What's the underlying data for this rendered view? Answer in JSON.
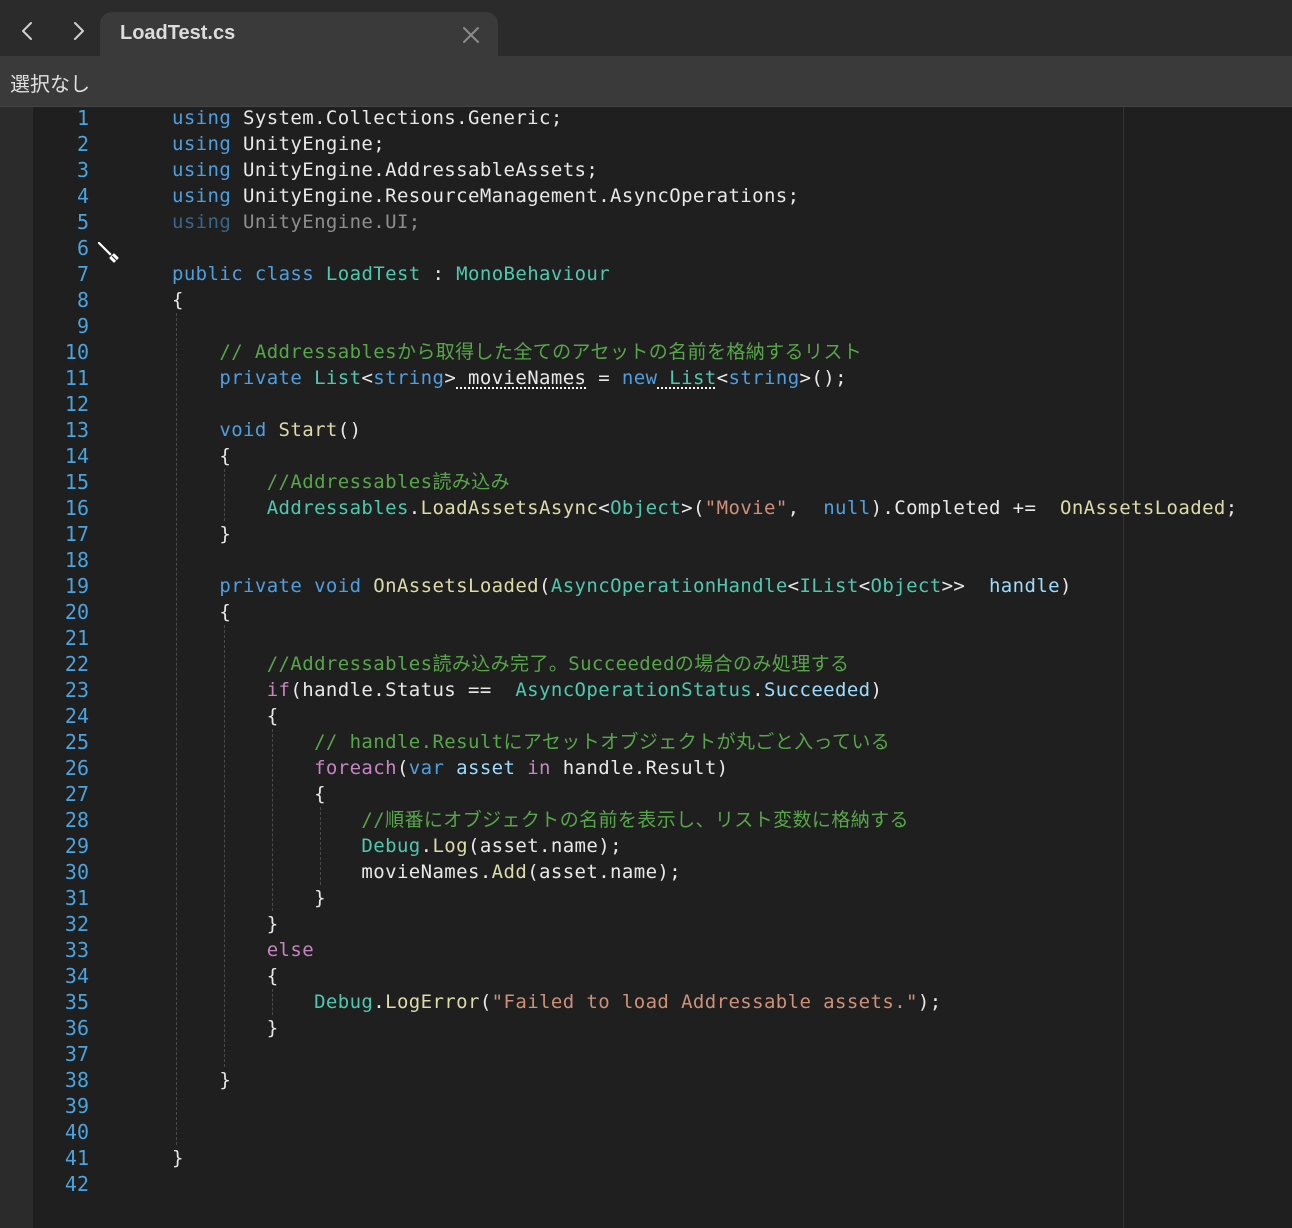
{
  "tab": {
    "title": "LoadTest.cs"
  },
  "breadcrumb": {
    "label": "選択なし"
  },
  "icons": {
    "back": "chevron-left-icon",
    "forward": "chevron-right-icon",
    "close": "close-icon",
    "cursor": "pencil-icon"
  },
  "colors": {
    "keyword": "#4f9fe0",
    "control": "#c586c0",
    "type": "#4ec9b0",
    "function": "#dcdcaa",
    "string": "#ce9178",
    "comment": "#57a64a",
    "variable": "#9cdcfe",
    "line_number": "#4aa3df",
    "editor_bg": "#1f1f1f"
  },
  "code": {
    "lines": [
      [
        [
          "kw",
          "using"
        ],
        [
          "",
          "System.Collections.Generic;"
        ]
      ],
      [
        [
          "kw",
          "using"
        ],
        [
          "",
          "UnityEngine;"
        ]
      ],
      [
        [
          "kw",
          "using"
        ],
        [
          "",
          "UnityEngine.AddressableAssets;"
        ]
      ],
      [
        [
          "kw",
          "using"
        ],
        [
          "",
          "UnityEngine.ResourceManagement.AsyncOperations;"
        ]
      ],
      [
        [
          "kw dim",
          "using"
        ],
        [
          "dim",
          "UnityEngine.UI;"
        ]
      ],
      [],
      [
        [
          "kw",
          "public"
        ],
        [
          "kw",
          "class"
        ],
        [
          "typ",
          "LoadTest"
        ],
        [
          "",
          ":"
        ],
        [
          "typ",
          "MonoBehaviour"
        ]
      ],
      [
        [
          "",
          "{"
        ]
      ],
      [],
      [
        [
          "cm",
          "    // Addressablesから取得した全てのアセットの名前を格納するリスト"
        ]
      ],
      [
        [
          "kw",
          "    private"
        ],
        [
          "typ",
          "List"
        ],
        [
          "",
          "<"
        ],
        [
          "kw",
          "string"
        ],
        [
          "",
          ">"
        ],
        [
          "squig",
          "movieNames"
        ],
        [
          "",
          "="
        ],
        [
          "kw",
          "new"
        ],
        [
          "typ squig",
          "List"
        ],
        [
          "",
          "<"
        ],
        [
          "kw",
          "string"
        ],
        [
          "",
          ">();"
        ]
      ],
      [],
      [
        [
          "kw",
          "    void"
        ],
        [
          "fn",
          "Start"
        ],
        [
          "",
          "()"
        ]
      ],
      [
        [
          "",
          "    {"
        ]
      ],
      [
        [
          "cm",
          "        //Addressables読み込み"
        ]
      ],
      [
        [
          "typ",
          "        Addressables"
        ],
        [
          "",
          "."
        ],
        [
          "fn",
          "LoadAssetsAsync"
        ],
        [
          "",
          "<"
        ],
        [
          "typ",
          "Object"
        ],
        [
          "",
          ">("
        ],
        [
          "str",
          "\"Movie\""
        ],
        [
          "",
          ", "
        ],
        [
          "kw",
          "null"
        ],
        [
          "",
          ").Completed += "
        ],
        [
          "fn",
          "OnAssetsLoaded"
        ],
        [
          "",
          ";"
        ]
      ],
      [
        [
          "",
          "    }"
        ]
      ],
      [],
      [
        [
          "kw",
          "    private"
        ],
        [
          "kw",
          "void"
        ],
        [
          "fn",
          "OnAssetsLoaded"
        ],
        [
          "",
          "("
        ],
        [
          "typ",
          "AsyncOperationHandle"
        ],
        [
          "",
          "<"
        ],
        [
          "typ",
          "IList"
        ],
        [
          "",
          "<"
        ],
        [
          "typ",
          "Object"
        ],
        [
          "",
          ">>"
        ],
        [
          "var",
          "handle"
        ],
        [
          "",
          ")"
        ]
      ],
      [
        [
          "",
          "    {"
        ]
      ],
      [],
      [
        [
          "cm",
          "        //Addressables読み込み完了。Succeededの場合のみ処理する"
        ]
      ],
      [
        [
          "ctl",
          "        if"
        ],
        [
          "",
          "(handle.Status == "
        ],
        [
          "typ",
          "AsyncOperationStatus"
        ],
        [
          "",
          "."
        ],
        [
          "var",
          "Succeeded"
        ],
        [
          "",
          ")"
        ]
      ],
      [
        [
          "",
          "        {"
        ]
      ],
      [
        [
          "cm",
          "            // handle.Resultにアセットオブジェクトが丸ごと入っている"
        ]
      ],
      [
        [
          "ctl",
          "            foreach"
        ],
        [
          "",
          "("
        ],
        [
          "kw",
          "var"
        ],
        [
          "var",
          "asset"
        ],
        [
          "ctl",
          "in"
        ],
        [
          "",
          "handle.Result)"
        ]
      ],
      [
        [
          "",
          "            {"
        ]
      ],
      [
        [
          "cm",
          "                //順番にオブジェクトの名前を表示し、リスト変数に格納する"
        ]
      ],
      [
        [
          "typ",
          "                Debug"
        ],
        [
          "",
          "."
        ],
        [
          "fn",
          "Log"
        ],
        [
          "",
          "(asset.name);"
        ]
      ],
      [
        [
          "",
          "                movieNames."
        ],
        [
          "fn",
          "Add"
        ],
        [
          "",
          "(asset.name);"
        ]
      ],
      [
        [
          "",
          "            }"
        ]
      ],
      [
        [
          "",
          "        }"
        ]
      ],
      [
        [
          "ctl",
          "        else"
        ]
      ],
      [
        [
          "",
          "        {"
        ]
      ],
      [
        [
          "typ",
          "            Debug"
        ],
        [
          "",
          "."
        ],
        [
          "fn",
          "LogError"
        ],
        [
          "",
          "("
        ],
        [
          "str",
          "\"Failed to load Addressable assets.\""
        ],
        [
          "",
          ");"
        ]
      ],
      [
        [
          "",
          "        }"
        ]
      ],
      [],
      [
        [
          "",
          "    }"
        ]
      ],
      [],
      [],
      [
        [
          "",
          "}"
        ]
      ],
      []
    ]
  }
}
